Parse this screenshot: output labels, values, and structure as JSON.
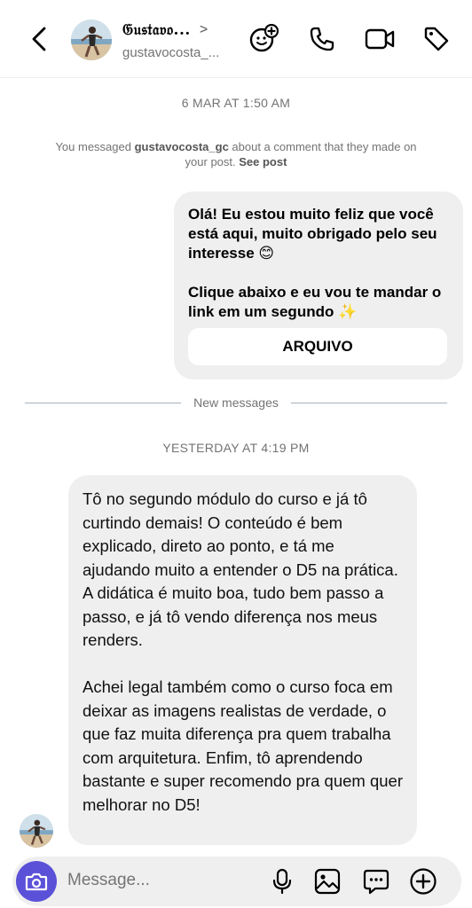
{
  "header": {
    "name": "𝔊𝔲𝔰𝔱𝔞𝔳𝔬...",
    "handle": "gustavocosta_...",
    "chevron": ">",
    "icons": [
      "back-arrow-icon",
      "effects-icon",
      "phone-icon",
      "video-icon",
      "tag-icon"
    ]
  },
  "thread": {
    "timestamp_1": "6 MAR AT 1:50 AM",
    "notice": {
      "prefix": "You messaged ",
      "user": "gustavocosta_gc",
      "middle": " about a comment that they made on your post. ",
      "link": "See post"
    },
    "outgoing": {
      "text": "Olá! Eu estou muito feliz que você está aqui, muito obrigado pelo seu interesse 😊\n\nClique abaixo e eu vou te mandar o link em um segundo ✨",
      "button_label": "ARQUIVO"
    },
    "divider_label": "New messages",
    "timestamp_2": "YESTERDAY AT 4:19 PM",
    "incoming": {
      "text": "Tô no segundo módulo do curso e já tô curtindo demais! O conteúdo é bem explicado, direto ao ponto, e tá me ajudando muito a entender o D5 na prática. A didática é muito boa, tudo bem passo a passo, e já tô vendo diferença nos meus renders.\n\nAchei legal também como o curso foca em deixar as imagens realistas de verdade, o que faz muita diferença pra quem trabalha com arquitetura. Enfim, tô aprendendo bastante e super recomendo pra quem quer melhorar no D5!"
    }
  },
  "composer": {
    "placeholder": "Message...",
    "icons": [
      "camera-icon",
      "microphone-icon",
      "gallery-icon",
      "sticker-icon",
      "add-icon"
    ]
  },
  "colors": {
    "accent": "#5b51d8",
    "bubble": "#efefef",
    "muted_text": "#737373"
  }
}
